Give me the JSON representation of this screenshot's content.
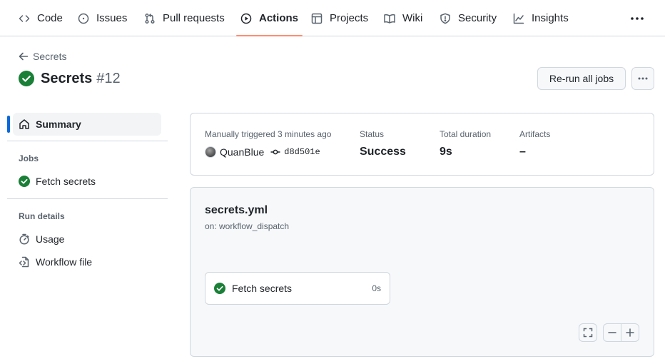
{
  "nav": {
    "tabs": [
      {
        "label": "Code",
        "icon": "code-icon"
      },
      {
        "label": "Issues",
        "icon": "issue-icon"
      },
      {
        "label": "Pull requests",
        "icon": "pull-request-icon"
      },
      {
        "label": "Actions",
        "icon": "play-icon",
        "active": true
      },
      {
        "label": "Projects",
        "icon": "table-icon"
      },
      {
        "label": "Wiki",
        "icon": "book-icon"
      },
      {
        "label": "Security",
        "icon": "shield-icon"
      },
      {
        "label": "Insights",
        "icon": "graph-icon"
      }
    ],
    "more_icon": "kebab-horizontal-icon"
  },
  "header": {
    "back_label": "Secrets",
    "workflow_name": "Secrets",
    "run_number": "#12",
    "status_icon": "check-circle-fill-icon",
    "rerun_label": "Re-run all jobs"
  },
  "sidebar": {
    "summary_label": "Summary",
    "jobs_heading": "Jobs",
    "jobs": [
      {
        "label": "Fetch secrets",
        "icon": "check-circle-fill-icon"
      }
    ],
    "run_details_heading": "Run details",
    "run_details": [
      {
        "label": "Usage",
        "icon": "stopwatch-icon"
      },
      {
        "label": "Workflow file",
        "icon": "file-code-icon"
      }
    ]
  },
  "summary": {
    "trigger_label": "Manually triggered 3 minutes ago",
    "actor": "QuanBlue",
    "commit": "d8d501e",
    "status_label": "Status",
    "status_value": "Success",
    "duration_label": "Total duration",
    "duration_value": "9s",
    "artifacts_label": "Artifacts",
    "artifacts_value": "–"
  },
  "graph": {
    "file_name": "secrets.yml",
    "trigger": "on: workflow_dispatch",
    "job": {
      "name": "Fetch secrets",
      "duration": "0s"
    }
  },
  "colors": {
    "success": "#1a7f37",
    "active_tab_underline": "#fd8c73",
    "sidebar_marker": "#0969da",
    "border": "#d0d7de"
  }
}
